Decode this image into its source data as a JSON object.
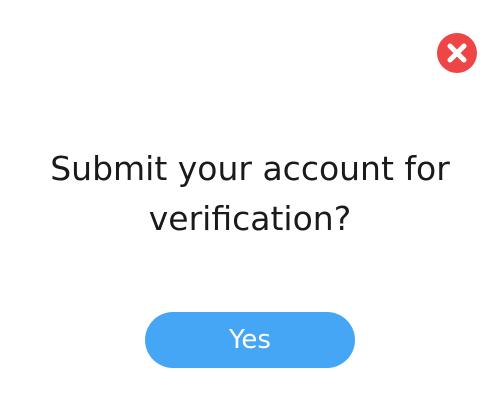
{
  "dialog": {
    "message": "Submit your account for verification?",
    "confirm_label": "Yes",
    "close_icon": "close-icon"
  },
  "colors": {
    "close_red": "#ee4646",
    "button_blue": "#45a6f5",
    "text_dark": "#1a1a1a",
    "background": "#ffffff"
  }
}
